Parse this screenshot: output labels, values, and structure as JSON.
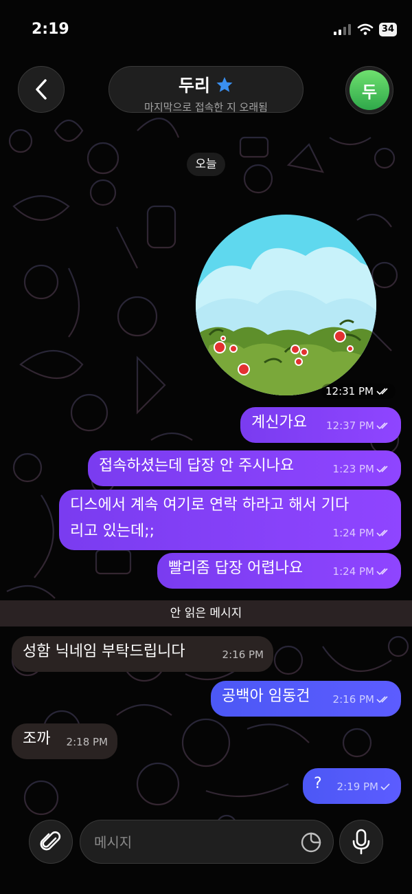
{
  "status_bar": {
    "time": "2:19",
    "battery": "34"
  },
  "header": {
    "title": "두리",
    "subtitle": "마지막으로 접속한 지 오래됨",
    "avatar_initial": "두"
  },
  "chat": {
    "date_label": "오늘",
    "sticker_time": "12:31 PM",
    "messages": [
      {
        "text": "계신가요",
        "time": "12:37 PM"
      },
      {
        "text": "접속하셨는데 답장 안 주시나요",
        "time": "1:23 PM"
      },
      {
        "text_line1": "디스에서 계속 여기로 연락 하라고 해서 기다",
        "text_line2": "리고 있는데;;",
        "time": "1:24 PM"
      },
      {
        "text": "빨리좀 답장 어렵나요",
        "time": "1:24 PM"
      },
      {
        "text": "성함 닉네임 부탁드립니다",
        "time": "2:16 PM"
      },
      {
        "text": "공백아 임동건",
        "time": "2:16 PM"
      },
      {
        "text": "조까",
        "time": "2:18 PM"
      },
      {
        "text": "?",
        "time": "2:19 PM"
      }
    ],
    "unread_label": "안 읽은 메시지"
  },
  "composer": {
    "placeholder": "메시지"
  },
  "colors": {
    "outgoing": "#8a44f8",
    "outgoing_latest": "#5656f7",
    "incoming": "#2a2322",
    "avatar": "#3cb64f"
  }
}
